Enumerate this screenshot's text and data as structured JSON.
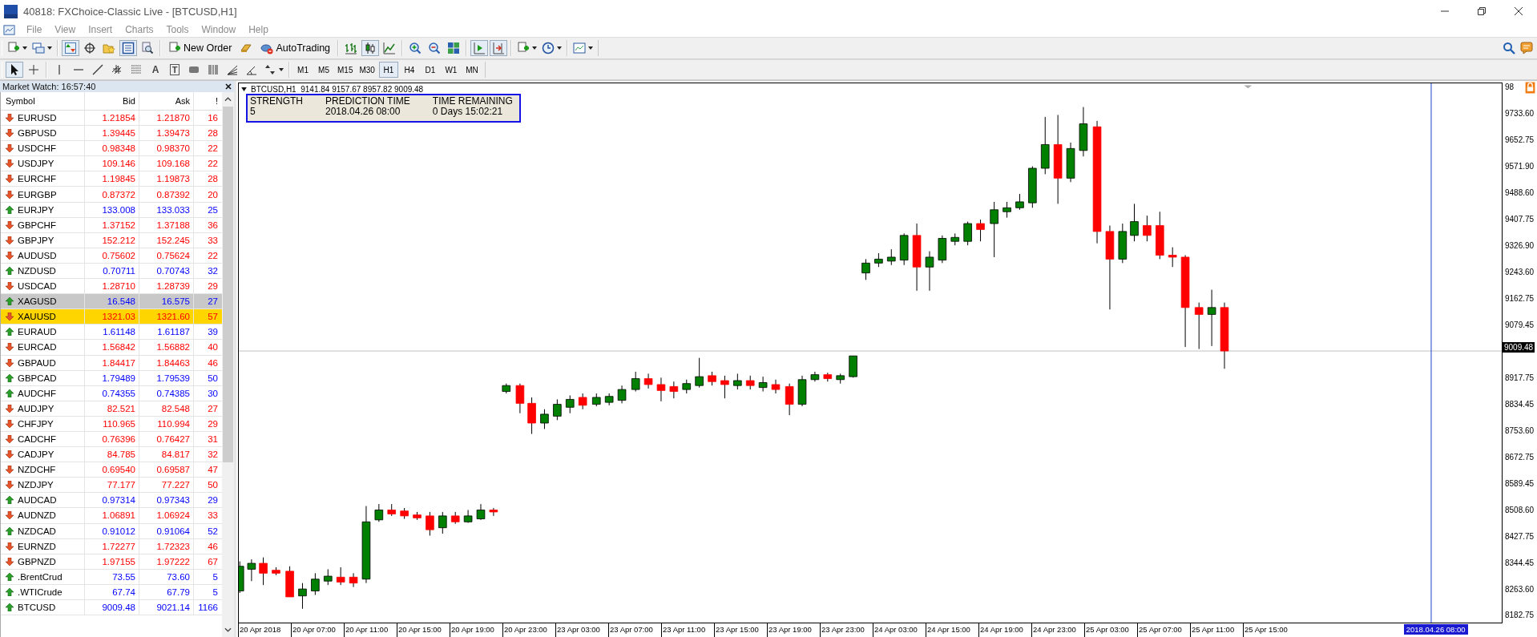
{
  "window": {
    "title": "40818: FXChoice-Classic Live - [BTCUSD,H1]"
  },
  "menu": [
    "File",
    "View",
    "Insert",
    "Charts",
    "Tools",
    "Window",
    "Help"
  ],
  "toolbar": {
    "new_order": "New Order",
    "auto_trading": "AutoTrading",
    "pressed": {
      "market_watch": true,
      "data_window": false,
      "navigator": false,
      "terminal": true,
      "bar_chart": false,
      "candlesticks": true,
      "line_chart": false,
      "auto_scroll": true,
      "chart_shift": true
    }
  },
  "drawing_toolbar": {
    "text_glyph": "A",
    "label_glyph": "T",
    "cursor_selected": true,
    "crosshair_selected": false
  },
  "periods": [
    {
      "label": "M1",
      "selected": false
    },
    {
      "label": "M5",
      "selected": false
    },
    {
      "label": "M15",
      "selected": false
    },
    {
      "label": "M30",
      "selected": false
    },
    {
      "label": "H1",
      "selected": true
    },
    {
      "label": "H4",
      "selected": false
    },
    {
      "label": "D1",
      "selected": false
    },
    {
      "label": "W1",
      "selected": false
    },
    {
      "label": "MN",
      "selected": false
    }
  ],
  "market_watch": {
    "title": "Market Watch: 16:57:40",
    "columns": [
      "Symbol",
      "Bid",
      "Ask",
      "!"
    ],
    "rows": [
      {
        "symbol": "EURUSD",
        "bid": "1.21854",
        "ask": "1.21870",
        "spread": "16",
        "rising": false,
        "selected": false,
        "highlighted": false
      },
      {
        "symbol": "GBPUSD",
        "bid": "1.39445",
        "ask": "1.39473",
        "spread": "28",
        "rising": false,
        "selected": false,
        "highlighted": false
      },
      {
        "symbol": "USDCHF",
        "bid": "0.98348",
        "ask": "0.98370",
        "spread": "22",
        "rising": false,
        "selected": false,
        "highlighted": false
      },
      {
        "symbol": "USDJPY",
        "bid": "109.146",
        "ask": "109.168",
        "spread": "22",
        "rising": false,
        "selected": false,
        "highlighted": false
      },
      {
        "symbol": "EURCHF",
        "bid": "1.19845",
        "ask": "1.19873",
        "spread": "28",
        "rising": false,
        "selected": false,
        "highlighted": false
      },
      {
        "symbol": "EURGBP",
        "bid": "0.87372",
        "ask": "0.87392",
        "spread": "20",
        "rising": false,
        "selected": false,
        "highlighted": false
      },
      {
        "symbol": "EURJPY",
        "bid": "133.008",
        "ask": "133.033",
        "spread": "25",
        "rising": true,
        "selected": false,
        "highlighted": false
      },
      {
        "symbol": "GBPCHF",
        "bid": "1.37152",
        "ask": "1.37188",
        "spread": "36",
        "rising": false,
        "selected": false,
        "highlighted": false
      },
      {
        "symbol": "GBPJPY",
        "bid": "152.212",
        "ask": "152.245",
        "spread": "33",
        "rising": false,
        "selected": false,
        "highlighted": false
      },
      {
        "symbol": "AUDUSD",
        "bid": "0.75602",
        "ask": "0.75624",
        "spread": "22",
        "rising": false,
        "selected": false,
        "highlighted": false
      },
      {
        "symbol": "NZDUSD",
        "bid": "0.70711",
        "ask": "0.70743",
        "spread": "32",
        "rising": true,
        "selected": false,
        "highlighted": false
      },
      {
        "symbol": "USDCAD",
        "bid": "1.28710",
        "ask": "1.28739",
        "spread": "29",
        "rising": false,
        "selected": false,
        "highlighted": false
      },
      {
        "symbol": "XAGUSD",
        "bid": "16.548",
        "ask": "16.575",
        "spread": "27",
        "rising": true,
        "selected": true,
        "highlighted": false
      },
      {
        "symbol": "XAUUSD",
        "bid": "1321.03",
        "ask": "1321.60",
        "spread": "57",
        "rising": false,
        "selected": false,
        "highlighted": true
      },
      {
        "symbol": "EURAUD",
        "bid": "1.61148",
        "ask": "1.61187",
        "spread": "39",
        "rising": true,
        "selected": false,
        "highlighted": false
      },
      {
        "symbol": "EURCAD",
        "bid": "1.56842",
        "ask": "1.56882",
        "spread": "40",
        "rising": false,
        "selected": false,
        "highlighted": false
      },
      {
        "symbol": "GBPAUD",
        "bid": "1.84417",
        "ask": "1.84463",
        "spread": "46",
        "rising": false,
        "selected": false,
        "highlighted": false
      },
      {
        "symbol": "GBPCAD",
        "bid": "1.79489",
        "ask": "1.79539",
        "spread": "50",
        "rising": true,
        "selected": false,
        "highlighted": false
      },
      {
        "symbol": "AUDCHF",
        "bid": "0.74355",
        "ask": "0.74385",
        "spread": "30",
        "rising": true,
        "selected": false,
        "highlighted": false
      },
      {
        "symbol": "AUDJPY",
        "bid": "82.521",
        "ask": "82.548",
        "spread": "27",
        "rising": false,
        "selected": false,
        "highlighted": false
      },
      {
        "symbol": "CHFJPY",
        "bid": "110.965",
        "ask": "110.994",
        "spread": "29",
        "rising": false,
        "selected": false,
        "highlighted": false
      },
      {
        "symbol": "CADCHF",
        "bid": "0.76396",
        "ask": "0.76427",
        "spread": "31",
        "rising": false,
        "selected": false,
        "highlighted": false
      },
      {
        "symbol": "CADJPY",
        "bid": "84.785",
        "ask": "84.817",
        "spread": "32",
        "rising": false,
        "selected": false,
        "highlighted": false
      },
      {
        "symbol": "NZDCHF",
        "bid": "0.69540",
        "ask": "0.69587",
        "spread": "47",
        "rising": false,
        "selected": false,
        "highlighted": false
      },
      {
        "symbol": "NZDJPY",
        "bid": "77.177",
        "ask": "77.227",
        "spread": "50",
        "rising": false,
        "selected": false,
        "highlighted": false
      },
      {
        "symbol": "AUDCAD",
        "bid": "0.97314",
        "ask": "0.97343",
        "spread": "29",
        "rising": true,
        "selected": false,
        "highlighted": false
      },
      {
        "symbol": "AUDNZD",
        "bid": "1.06891",
        "ask": "1.06924",
        "spread": "33",
        "rising": false,
        "selected": false,
        "highlighted": false
      },
      {
        "symbol": "NZDCAD",
        "bid": "0.91012",
        "ask": "0.91064",
        "spread": "52",
        "rising": true,
        "selected": false,
        "highlighted": false
      },
      {
        "symbol": "EURNZD",
        "bid": "1.72277",
        "ask": "1.72323",
        "spread": "46",
        "rising": false,
        "selected": false,
        "highlighted": false
      },
      {
        "symbol": "GBPNZD",
        "bid": "1.97155",
        "ask": "1.97222",
        "spread": "67",
        "rising": false,
        "selected": false,
        "highlighted": false
      },
      {
        "symbol": ".BrentCrud",
        "bid": "73.55",
        "ask": "73.60",
        "spread": "5",
        "rising": true,
        "selected": false,
        "highlighted": false
      },
      {
        "symbol": ".WTICrude",
        "bid": "67.74",
        "ask": "67.79",
        "spread": "5",
        "rising": true,
        "selected": false,
        "highlighted": false
      },
      {
        "symbol": "BTCUSD",
        "bid": "9009.48",
        "ask": "9021.14",
        "spread": "1166",
        "rising": true,
        "selected": false,
        "highlighted": false
      }
    ]
  },
  "chart": {
    "header": "BTCUSD,H1  9141.84 9157.67 8957.82 9009.48",
    "info_box": [
      {
        "heading": "STRENGTH",
        "value": "5"
      },
      {
        "heading": "PREDICTION TIME",
        "value": "2018.04.26 08:00"
      },
      {
        "heading": "TIME REMAINING",
        "value": "0 Days 15:02:21"
      }
    ],
    "price_labels": [
      "98",
      "9733.60",
      "9652.75",
      "9571.90",
      "9488.60",
      "9407.75",
      "9326.90",
      "9243.60",
      "9162.75",
      "9079.45",
      "8917.75",
      "8834.45",
      "8753.60",
      "8672.75",
      "8589.45",
      "8508.60",
      "8427.75",
      "8344.45",
      "8263.60",
      "8182.75"
    ],
    "current_price": "9009.48",
    "time_labels": [
      "20 Apr 2018",
      "20 Apr 07:00",
      "20 Apr 11:00",
      "20 Apr 15:00",
      "20 Apr 19:00",
      "20 Apr 23:00",
      "23 Apr 03:00",
      "23 Apr 07:00",
      "23 Apr 11:00",
      "23 Apr 15:00",
      "23 Apr 19:00",
      "23 Apr 23:00",
      "24 Apr 03:00",
      "24 Apr 15:00",
      "24 Apr 19:00",
      "24 Apr 23:00",
      "25 Apr 03:00",
      "25 Apr 07:00",
      "25 Apr 11:00",
      "25 Apr 15:00"
    ],
    "cursor_time": "2018.04.26 08:00"
  }
}
